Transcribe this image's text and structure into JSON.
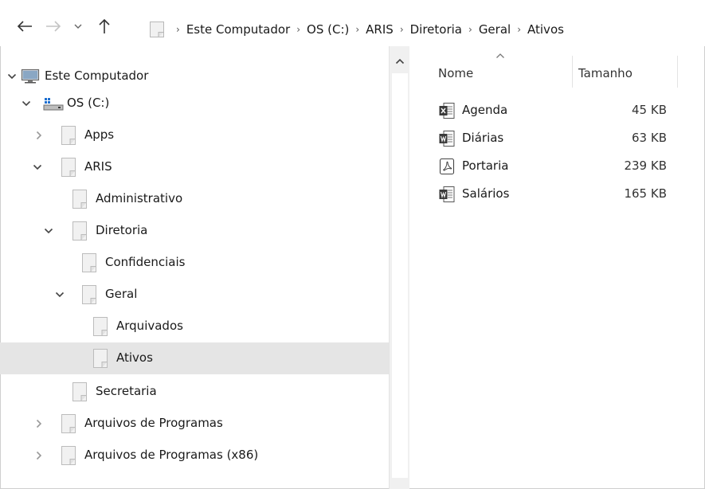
{
  "addressbar": {
    "breadcrumbs": [
      "Este Computador",
      "OS (C:)",
      "ARIS",
      "Diretoria",
      "Geral",
      "Ativos"
    ]
  },
  "tree": {
    "items": [
      {
        "label": "Este Computador",
        "icon": "monitor-icon",
        "expanded": true
      },
      {
        "label": "OS (C:)",
        "icon": "drive-icon",
        "expanded": true
      },
      {
        "label": "Apps",
        "icon": "folder-icon",
        "expanded": false
      },
      {
        "label": "ARIS",
        "icon": "folder-icon",
        "expanded": true
      },
      {
        "label": "Administrativo",
        "icon": "folder-icon"
      },
      {
        "label": "Diretoria",
        "icon": "folder-icon",
        "expanded": true
      },
      {
        "label": "Confidenciais",
        "icon": "folder-icon"
      },
      {
        "label": "Geral",
        "icon": "folder-icon",
        "expanded": true
      },
      {
        "label": "Arquivados",
        "icon": "folder-icon"
      },
      {
        "label": "Ativos",
        "icon": "folder-icon",
        "selected": true
      },
      {
        "label": "Secretaria",
        "icon": "folder-icon"
      },
      {
        "label": "Arquivos de Programas",
        "icon": "folder-icon",
        "expanded": false
      },
      {
        "label": "Arquivos de Programas (x86)",
        "icon": "folder-icon",
        "expanded": false
      }
    ]
  },
  "list": {
    "columns": [
      "Nome",
      "Tamanho"
    ],
    "files": [
      {
        "name": "Agenda",
        "size": "45 KB",
        "icon": "excel-icon"
      },
      {
        "name": "Diárias",
        "size": "63 KB",
        "icon": "word-icon"
      },
      {
        "name": "Portaria",
        "size": "239 KB",
        "icon": "pdf-icon"
      },
      {
        "name": "Salários",
        "size": "165 KB",
        "icon": "word-icon"
      }
    ]
  },
  "colors": {
    "selected_row": "#e5e5e5",
    "scrollbar": "#f0f0f0"
  }
}
